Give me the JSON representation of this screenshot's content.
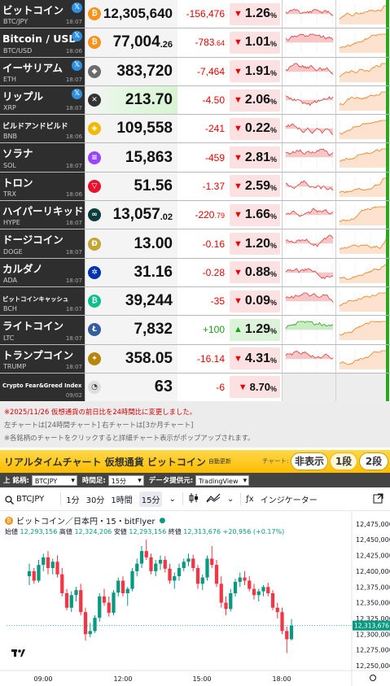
{
  "rows": [
    {
      "name": "ビットコイン",
      "sym": "BTC/JPY",
      "time": "18:07",
      "x": true,
      "coin": "₿",
      "coin_color": "#f7931a",
      "price": "12,305,640",
      "price_frac": "",
      "change": "-156,476",
      "change_frac": "",
      "dir": "down",
      "pct": "1.26",
      "big": true
    },
    {
      "name": "Bitcoin / USD",
      "sym": "BTC/USD",
      "time": "18:06",
      "x": true,
      "coin": "₿",
      "coin_color": "#f7931a",
      "price": "77,004",
      "price_frac": ".26",
      "change": "-783",
      "change_frac": ".64",
      "dir": "down",
      "pct": "1.01"
    },
    {
      "name": "イーサリアム",
      "sym": "ETH",
      "time": "18:07",
      "x": true,
      "coin": "◆",
      "coin_color": "#6b6b6b",
      "price": "383,720",
      "price_frac": "",
      "change": "-7,464",
      "change_frac": "",
      "dir": "down",
      "pct": "1.91"
    },
    {
      "name": "リップル",
      "sym": "XRP",
      "time": "18:07",
      "x": true,
      "coin": "✕",
      "coin_color": "#333333",
      "price": "213.70",
      "price_frac": "",
      "change": "-4.50",
      "change_frac": "",
      "dir": "down",
      "pct": "2.06",
      "hl": true
    },
    {
      "name": "ビルドアンドビルド",
      "sym": "BNB",
      "time": "18:06",
      "x": false,
      "coin": "◈",
      "coin_color": "#f0b90b",
      "price": "109,558",
      "price_frac": "",
      "change": "-241",
      "change_frac": "",
      "dir": "down",
      "pct": "0.22",
      "small": true
    },
    {
      "name": "ソラナ",
      "sym": "SOL",
      "time": "18:07",
      "x": false,
      "coin": "≡",
      "coin_color": "#9945ff",
      "price": "15,863",
      "price_frac": "",
      "change": "-459",
      "change_frac": "",
      "dir": "down",
      "pct": "2.81"
    },
    {
      "name": "トロン",
      "sym": "TRX",
      "time": "18:06",
      "x": false,
      "coin": "▽",
      "coin_color": "#e8112d",
      "price": "51.56",
      "price_frac": "",
      "change": "-1.37",
      "change_frac": "",
      "dir": "down",
      "pct": "2.59"
    },
    {
      "name": "ハイパーリキッド",
      "sym": "HYPE",
      "time": "18:07",
      "x": false,
      "coin": "∞",
      "coin_color": "#0b3d3a",
      "price": "13,057",
      "price_frac": ".02",
      "change": "-220",
      "change_frac": ".79",
      "dir": "down",
      "pct": "1.66"
    },
    {
      "name": "ドージコイン",
      "sym": "DOGE",
      "time": "18:07",
      "x": false,
      "coin": "Ð",
      "coin_color": "#c2a633",
      "price": "13.00",
      "price_frac": "",
      "change": "-0.16",
      "change_frac": "",
      "dir": "down",
      "pct": "1.20"
    },
    {
      "name": "カルダノ",
      "sym": "ADA",
      "time": "18:07",
      "x": false,
      "coin": "✲",
      "coin_color": "#0033ad",
      "price": "31.16",
      "price_frac": "",
      "change": "-0.28",
      "change_frac": "",
      "dir": "down",
      "pct": "0.88"
    },
    {
      "name": "ビットコインキャッシュ",
      "sym": "BCH",
      "time": "18:07",
      "x": false,
      "coin": "₿",
      "coin_color": "#0ac18e",
      "price": "39,244",
      "price_frac": "",
      "change": "-35",
      "change_frac": "",
      "dir": "down",
      "pct": "0.09",
      "xsmall": true
    },
    {
      "name": "ライトコイン",
      "sym": "LTC",
      "time": "18:07",
      "x": false,
      "coin": "Ł",
      "coin_color": "#345d9d",
      "price": "7,832",
      "price_frac": "",
      "change": "+100",
      "change_frac": "",
      "dir": "up",
      "pct": "1.29"
    },
    {
      "name": "トランプコイン",
      "sym": "TRUMP",
      "time": "18:07",
      "x": false,
      "coin": "✦",
      "coin_color": "#b8860b",
      "price": "358.05",
      "price_frac": "",
      "change": "-16.14",
      "change_frac": "",
      "dir": "down",
      "pct": "4.31"
    }
  ],
  "feargreed": {
    "name": "Crypto Fear&Greed Index",
    "date": "09/02",
    "value": "63",
    "change": "-6",
    "pct": "8.70"
  },
  "notes": {
    "line1": "※2025/11/26 仮想通貨の前日比を24時間比に変更しました。",
    "line2": "左チャートは[24時間チャート] 右チャートは[3か月チャート]",
    "line3": "※各銘柄のチャートをクリックすると詳細チャート表示がポップアップされます。"
  },
  "rt_header": {
    "title": "リアルタイムチャート 仮想通貨 ビットコイン",
    "sub": "自動更新",
    "chart_label": "チャート:",
    "seg_hide": "非表示",
    "seg_one": "1段",
    "seg_two": "2段"
  },
  "controls": {
    "symbol_label": "上 銘柄:",
    "symbol": "BTCJPY",
    "timeframe_label": "時間足:",
    "timeframe": "15分足",
    "provider_label": "データ提供元:",
    "provider": "TradingView"
  },
  "toolbar": {
    "symbol": "BTCJPY",
    "tf1": "1分",
    "tf2": "30分",
    "tf3": "1時間",
    "tf4": "15分",
    "indicators": "インジケーター"
  },
  "main_chart": {
    "legend_title": "ビットコイン／日本円・15・bitFlyer",
    "o_label": "始値",
    "o": "12,293,156",
    "h_label": "高値",
    "h": "12,324,206",
    "l_label": "安値",
    "l": "12,293,156",
    "c_label": "終値",
    "c": "12,313,676",
    "chg": "+20,956 (+0.17%)",
    "last_price_tag": "12,313,676",
    "y_ticks": [
      "12,475,000",
      "12,450,000",
      "12,425,000",
      "12,400,000",
      "12,375,000",
      "12,350,000",
      "12,325,000",
      "12,300,000",
      "12,275,000",
      "12,250,000"
    ],
    "x_ticks": [
      "09:00",
      "12:00",
      "15:00",
      "18:00"
    ],
    "colors": {
      "up": "#089981",
      "down": "#f23645"
    }
  },
  "chart_data": {
    "type": "candlestick",
    "title": "ビットコイン／日本円・15・bitFlyer",
    "ylim": [
      12250000,
      12480000
    ],
    "x_ticks": [
      "09:00",
      "12:00",
      "15:00",
      "18:00"
    ],
    "candles": [
      [
        12392000,
        12412000,
        12378000,
        12400000
      ],
      [
        12400000,
        12405000,
        12380000,
        12385000
      ],
      [
        12385000,
        12418000,
        12382000,
        12410000
      ],
      [
        12410000,
        12428000,
        12400000,
        12422000
      ],
      [
        12422000,
        12432000,
        12395000,
        12405000
      ],
      [
        12405000,
        12420000,
        12395000,
        12415000
      ],
      [
        12415000,
        12425000,
        12390000,
        12395000
      ],
      [
        12395000,
        12405000,
        12360000,
        12365000
      ],
      [
        12365000,
        12372000,
        12338000,
        12342000
      ],
      [
        12342000,
        12368000,
        12335000,
        12362000
      ],
      [
        12362000,
        12375000,
        12352000,
        12370000
      ],
      [
        12370000,
        12380000,
        12330000,
        12335000
      ],
      [
        12335000,
        12342000,
        12290000,
        12300000
      ],
      [
        12300000,
        12318000,
        12295000,
        12305000
      ],
      [
        12305000,
        12330000,
        12302000,
        12326000
      ],
      [
        12326000,
        12365000,
        12320000,
        12360000
      ],
      [
        12360000,
        12372000,
        12345000,
        12350000
      ],
      [
        12350000,
        12360000,
        12328000,
        12334000
      ],
      [
        12334000,
        12370000,
        12330000,
        12366000
      ],
      [
        12366000,
        12390000,
        12360000,
        12385000
      ],
      [
        12385000,
        12392000,
        12360000,
        12365000
      ],
      [
        12365000,
        12375000,
        12345000,
        12372000
      ],
      [
        12372000,
        12405000,
        12368000,
        12400000
      ],
      [
        12400000,
        12420000,
        12392000,
        12412000
      ],
      [
        12412000,
        12440000,
        12405000,
        12432000
      ],
      [
        12432000,
        12450000,
        12418000,
        12422000
      ],
      [
        12422000,
        12428000,
        12395000,
        12400000
      ],
      [
        12400000,
        12418000,
        12392000,
        12412000
      ],
      [
        12412000,
        12425000,
        12402000,
        12418000
      ],
      [
        12418000,
        12424000,
        12398000,
        12404000
      ],
      [
        12404000,
        12412000,
        12380000,
        12385000
      ],
      [
        12385000,
        12398000,
        12372000,
        12392000
      ],
      [
        12392000,
        12412000,
        12385000,
        12405000
      ],
      [
        12405000,
        12420000,
        12400000,
        12415000
      ],
      [
        12415000,
        12428000,
        12408000,
        12420000
      ],
      [
        12420000,
        12426000,
        12400000,
        12405000
      ],
      [
        12405000,
        12410000,
        12372000,
        12380000
      ],
      [
        12380000,
        12395000,
        12370000,
        12390000
      ],
      [
        12390000,
        12425000,
        12385000,
        12420000
      ],
      [
        12420000,
        12440000,
        12405000,
        12410000
      ],
      [
        12410000,
        12418000,
        12375000,
        12380000
      ],
      [
        12380000,
        12392000,
        12342000,
        12350000
      ],
      [
        12350000,
        12360000,
        12330000,
        12340000
      ],
      [
        12340000,
        12372000,
        12336000,
        12365000
      ],
      [
        12365000,
        12388000,
        12360000,
        12383000
      ],
      [
        12383000,
        12398000,
        12375000,
        12390000
      ],
      [
        12390000,
        12400000,
        12378000,
        12385000
      ],
      [
        12385000,
        12392000,
        12368000,
        12372000
      ],
      [
        12372000,
        12380000,
        12355000,
        12362000
      ],
      [
        12362000,
        12372000,
        12352000,
        12368000
      ],
      [
        12368000,
        12378000,
        12360000,
        12375000
      ],
      [
        12375000,
        12382000,
        12360000,
        12365000
      ],
      [
        12365000,
        12370000,
        12338000,
        12342000
      ],
      [
        12342000,
        12350000,
        12325000,
        12335000
      ],
      [
        12335000,
        12342000,
        12300000,
        12305000
      ],
      [
        12305000,
        12312000,
        12270000,
        12292000
      ],
      [
        12292000,
        12324000,
        12290000,
        12313676
      ]
    ]
  }
}
